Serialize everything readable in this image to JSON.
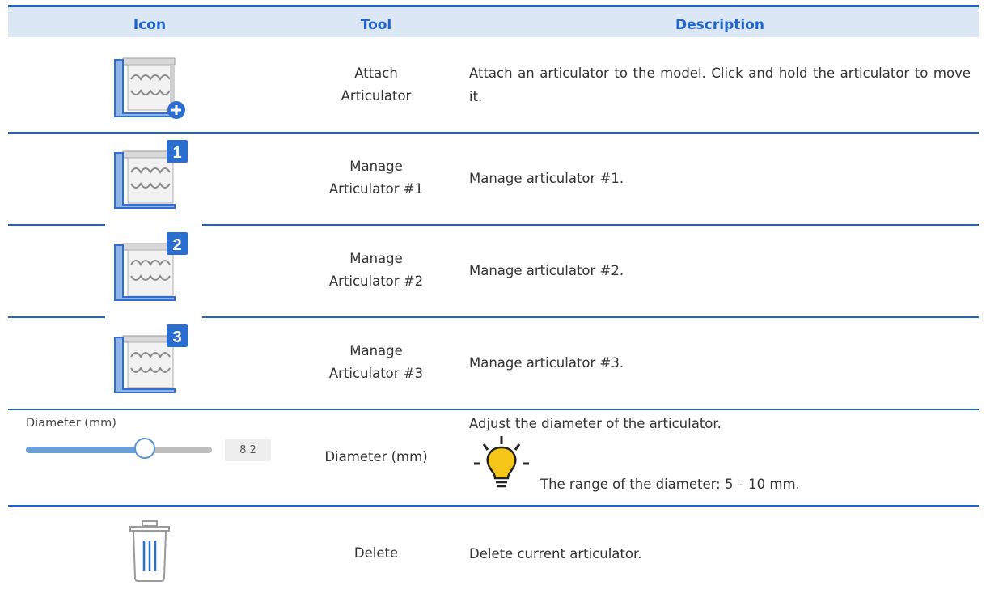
{
  "header": {
    "icon": "Icon",
    "tool": "Tool",
    "description": "Description"
  },
  "rows": [
    {
      "icon": "articulator-add-icon",
      "tool": "Attach\nArticulator",
      "description": "Attach an articulator to the model. Click and hold the articulator to move it."
    },
    {
      "icon": "articulator-1-icon",
      "badge": "1",
      "tool": "Manage\nArticulator #1",
      "description": "Manage articulator #1."
    },
    {
      "icon": "articulator-2-icon",
      "badge": "2",
      "tool": "Manage\nArticulator #2",
      "description": "Manage articulator #2."
    },
    {
      "icon": "articulator-3-icon",
      "badge": "3",
      "tool": "Manage\nArticulator #3",
      "description": "Manage articulator #3."
    },
    {
      "icon": "diameter-slider",
      "tool": "Diameter (mm)",
      "description": "Adjust the diameter of the articulator.",
      "tip": "The range of the diameter: 5 – 10 mm.",
      "slider": {
        "label": "Diameter (mm)",
        "value": "8.2",
        "fill_fraction": 0.64
      }
    },
    {
      "icon": "trash-icon",
      "tool": "Delete",
      "description": "Delete current articulator."
    }
  ],
  "colors": {
    "accent": "#1f64c8",
    "header_bg": "#dbe7f5",
    "badge": "#2a6fcf",
    "bulb": "#f5c518"
  }
}
